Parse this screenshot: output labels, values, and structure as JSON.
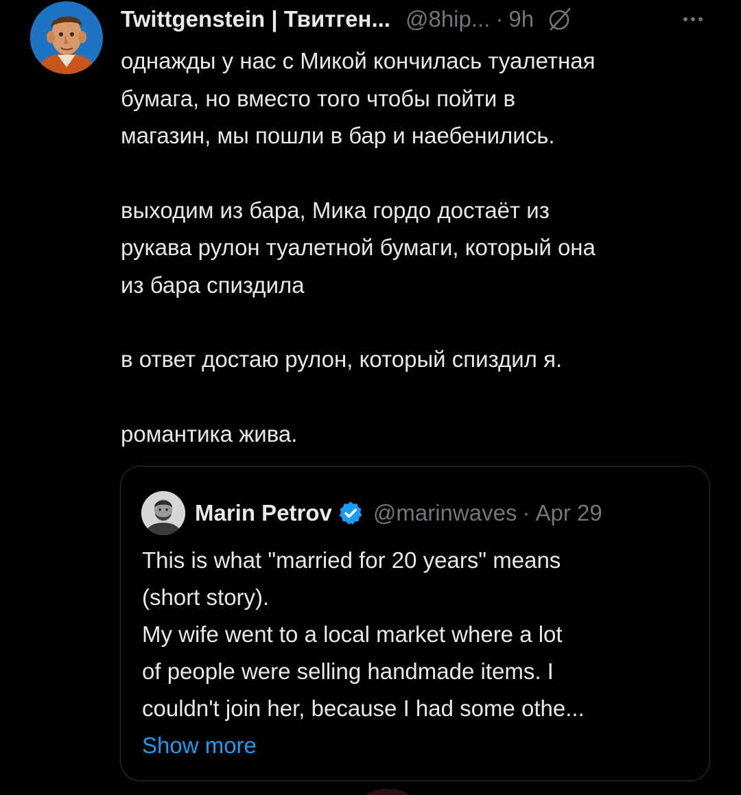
{
  "tweet": {
    "display_name": "Twittgenstein | Твитген...",
    "handle": "@8hip...",
    "separator": "·",
    "time": "9h",
    "paragraphs": [
      "однажды у нас с Микой кончилась туалетная\nбумага, но вместо того чтобы пойти в\nмагазин, мы пошли в бар и наебенились.",
      "выходим из бара, Мика гордо достаёт из\nрукава рулон туалетной бумаги, который она\nиз бара спиздила",
      "в ответ достаю рулон, который спиздил я.",
      "романтика жива."
    ]
  },
  "quote": {
    "display_name": "Marin Petrov",
    "handle": "@marinwaves",
    "separator": "·",
    "time": "Apr 29",
    "text": "This is what \"married for 20 years\" means\n(short story).\nMy wife went to a local market where a lot\nof people were selling handmade items. I\ncouldn't join her, because I had some othe...",
    "show_more": "Show more"
  },
  "icons": {
    "grok": "grok-icon",
    "more": "more-options-icon",
    "verified": "verified-badge-icon"
  },
  "colors": {
    "background": "#000000",
    "text": "#e7e9ea",
    "muted": "#71767b",
    "accent": "#1d9bf0",
    "border": "#2f3336"
  }
}
